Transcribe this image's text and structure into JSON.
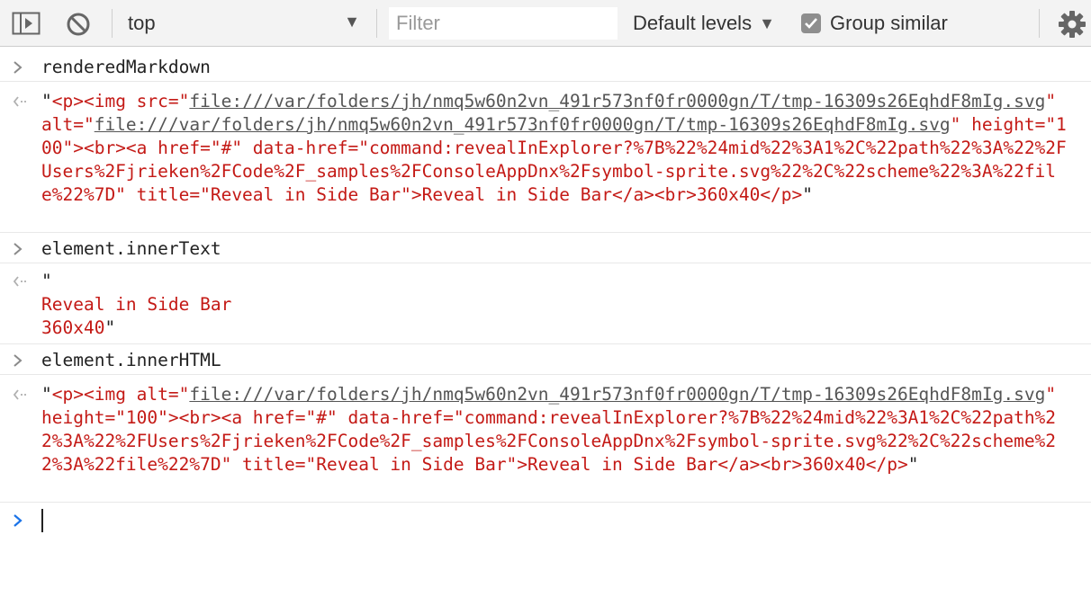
{
  "toolbar": {
    "context": "top",
    "filter_placeholder": "Filter",
    "levels_label": "Default levels",
    "group_similar_label": "Group similar",
    "group_similar_checked": true,
    "icons": [
      "sidebar-toggle-icon",
      "clear-console-icon",
      "dropdown-caret-icon",
      "checkbox-check-icon",
      "gear-icon"
    ]
  },
  "console": {
    "entries": [
      {
        "input": "renderedMarkdown",
        "result_parts": [
          "\"",
          "<p><img src=\"",
          "file:///var/folders/jh/nmq5w60n2vn_491r573nf0fr0000gn/T/tmp-16309s26EqhdF8mIg.svg",
          "\" alt=\"",
          "file:///var/folders/jh/nmq5w60n2vn_491r573nf0fr0000gn/T/tmp-16309s26EqhdF8mIg.svg",
          "\" height=\"100\"><br><a href=\"#\" data-href=\"command:revealInExplorer?%7B%22%24mid%22%3A1%2C%22path%22%3A%22%2FUsers%2Fjrieken%2FCode%2F_samples%2FConsoleAppDnx%2Fsymbol-sprite.svg%22%2C%22scheme%22%3A%22file%22%7D\" title=\"Reveal in Side Bar\">Reveal in Side Bar</a><br>360x40</p>",
          "\""
        ]
      },
      {
        "input": "element.innerText",
        "result_parts": [
          "\"",
          "\nReveal in Side Bar\n360x40",
          "\""
        ]
      },
      {
        "input": "element.innerHTML",
        "result_parts": [
          "\"",
          "<p><img alt=\"",
          "file:///var/folders/jh/nmq5w60n2vn_491r573nf0fr0000gn/T/tmp-16309s26EqhdF8mIg.svg",
          "\" height=\"100\"><br><a href=\"#\" data-href=\"command:revealInExplorer?%7B%22%24mid%22%3A1%2C%22path%22%3A%22%2FUsers%2Fjrieken%2FCode%2F_samples%2FConsoleAppDnx%2Fsymbol-sprite.svg%22%2C%22scheme%22%3A%22file%22%7D\" title=\"Reveal in Side Bar\">Reveal in Side Bar</a><br>360x40</p>",
          "\""
        ]
      }
    ],
    "prompt_value": ""
  },
  "colors": {
    "string": "#c41a16",
    "prompt_caret": "#1a73e8",
    "gutter_icon": "#8a8a8a"
  }
}
